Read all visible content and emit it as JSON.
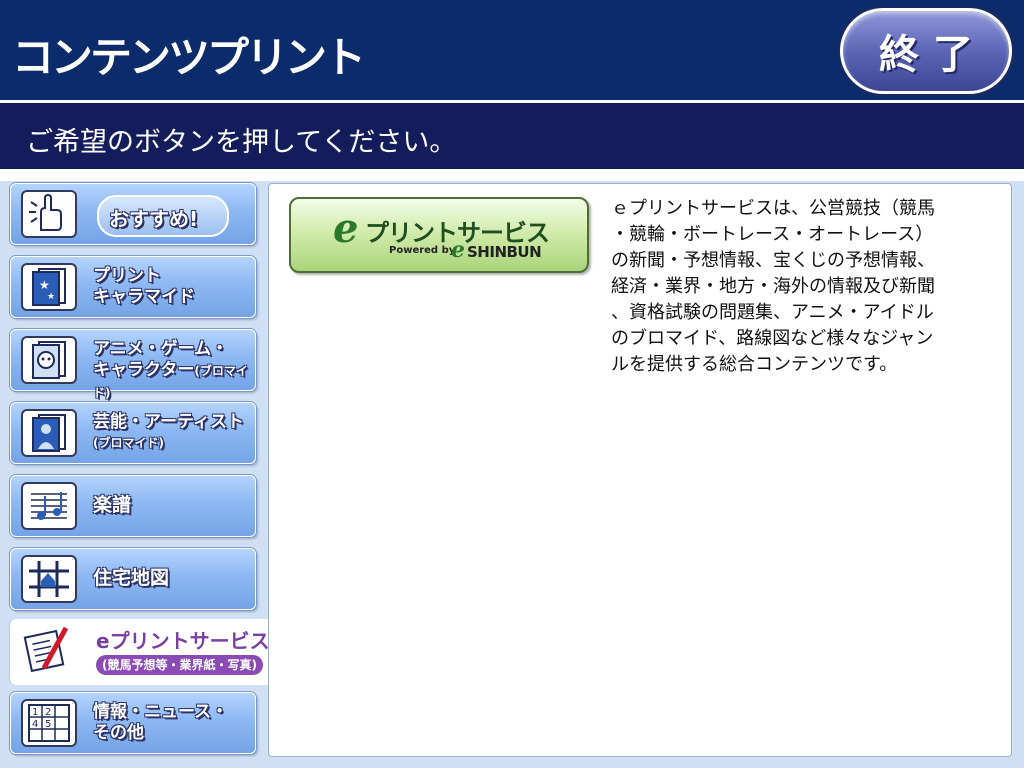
{
  "header": {
    "title": "コンテンツプリント",
    "exit_label": "終了"
  },
  "instruction": "ご希望のボタンを押してください。",
  "sidebar": {
    "items": [
      {
        "label": "おすすめ!"
      },
      {
        "label_line1": "プリント",
        "label_line2": "キャラマイド"
      },
      {
        "label_line1": "アニメ・ゲーム・",
        "label_line2": "キャラクター",
        "label_sub": "(ブロマイド)"
      },
      {
        "label_line1": "芸能・アーティスト",
        "label_line2": "(ブロマイド)"
      },
      {
        "label": "楽譜"
      },
      {
        "label": "住宅地図"
      },
      {
        "label_line1": "eプリントサービス",
        "label_line2": "(競馬予想等・業界紙・写真)",
        "selected": true
      },
      {
        "label_line1": "情報・ニュース・",
        "label_line2": "その他"
      }
    ]
  },
  "service_button": {
    "title": "プリントサービス",
    "powered_by": "Powered by",
    "sponsor": "SHINBUN"
  },
  "description": "ｅプリントサービスは、公営競技（競馬\n・競輪・ボートレース・オートレース）\nの新聞・予想情報、宝くじの予想情報、\n経済・業界・地方・海外の情報及び新聞\n、資格試験の問題集、アニメ・アイドル\nのブロマイド、路線図など様々なジャン\nルを提供する総合コンテンツです。",
  "icons": [
    "hand-pointer-icon",
    "photo-stack-icon",
    "character-card-icon",
    "artist-photo-icon",
    "sheet-music-icon",
    "house-map-icon",
    "newspaper-pen-icon",
    "info-grid-icon"
  ],
  "colors": {
    "header_bg": "#0c2b6b",
    "instruction_bg": "#141d5b",
    "button_blue": "#8db8f2",
    "selected_purple": "#8a4bb5",
    "service_green": "#a9d47a"
  }
}
